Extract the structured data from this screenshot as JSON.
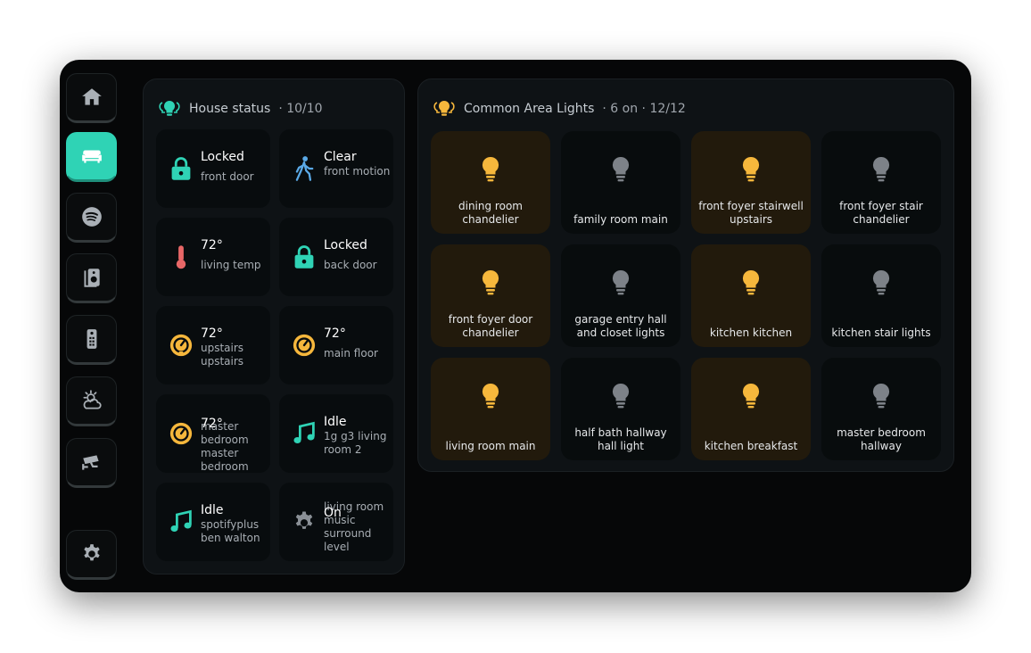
{
  "colors": {
    "accent": "#2fd3b5",
    "light_on": "#f6b73c",
    "light_off": "#7d8288",
    "tile_on_bg": "#221a0c"
  },
  "sidebar": {
    "items": [
      {
        "name": "home",
        "icon": "home-icon",
        "active": false
      },
      {
        "name": "rooms",
        "icon": "sofa-icon",
        "active": true
      },
      {
        "name": "spotify",
        "icon": "spotify-icon",
        "active": false
      },
      {
        "name": "speakers",
        "icon": "speaker-icon",
        "active": false
      },
      {
        "name": "remote",
        "icon": "remote-icon",
        "active": false
      },
      {
        "name": "weather",
        "icon": "weather-icon",
        "active": false
      },
      {
        "name": "cameras",
        "icon": "cctv-icon",
        "active": false
      },
      {
        "name": "settings",
        "icon": "gear-icon",
        "active": false
      }
    ]
  },
  "house_status": {
    "title": "House status",
    "count": "· 10/10",
    "tiles": [
      {
        "icon": "lock-icon",
        "primary": "Locked",
        "secondary": "front door"
      },
      {
        "icon": "walking-person-icon",
        "primary": "Clear",
        "secondary": "front motion"
      },
      {
        "icon": "thermometer-icon",
        "primary": "72°",
        "secondary": "living temp"
      },
      {
        "icon": "lock-icon",
        "primary": "Locked",
        "secondary": "back door"
      },
      {
        "icon": "thermostat-icon",
        "primary": "72°",
        "secondary": "upstairs upstairs"
      },
      {
        "icon": "thermostat-icon",
        "primary": "72°",
        "secondary": "main floor"
      },
      {
        "icon": "thermostat-icon",
        "primary": "72°",
        "secondary": "master bedroom master bedroom"
      },
      {
        "icon": "music-note-icon",
        "primary": "Idle",
        "secondary": "1g g3 living room 2"
      },
      {
        "icon": "music-note-icon",
        "primary": "Idle",
        "secondary": "spotifyplus ben walton"
      },
      {
        "icon": "gear-icon",
        "primary": "On",
        "secondary": "living room music surround level"
      }
    ]
  },
  "common_lights": {
    "title": "Common Area Lights",
    "count": "· 6 on · 12/12",
    "lights": [
      {
        "name": "dining room chandelier",
        "on": true
      },
      {
        "name": "family room main",
        "on": false
      },
      {
        "name": "front foyer stairwell upstairs",
        "on": true
      },
      {
        "name": "front foyer stair chandelier",
        "on": false
      },
      {
        "name": "front foyer door chandelier",
        "on": true
      },
      {
        "name": "garage entry hall and closet lights",
        "on": false
      },
      {
        "name": "kitchen kitchen",
        "on": true
      },
      {
        "name": "kitchen stair lights",
        "on": false
      },
      {
        "name": "living room main",
        "on": true
      },
      {
        "name": "half bath hallway hall light",
        "on": false
      },
      {
        "name": "kitchen breakfast",
        "on": true
      },
      {
        "name": "master bedroom hallway",
        "on": false
      }
    ]
  }
}
